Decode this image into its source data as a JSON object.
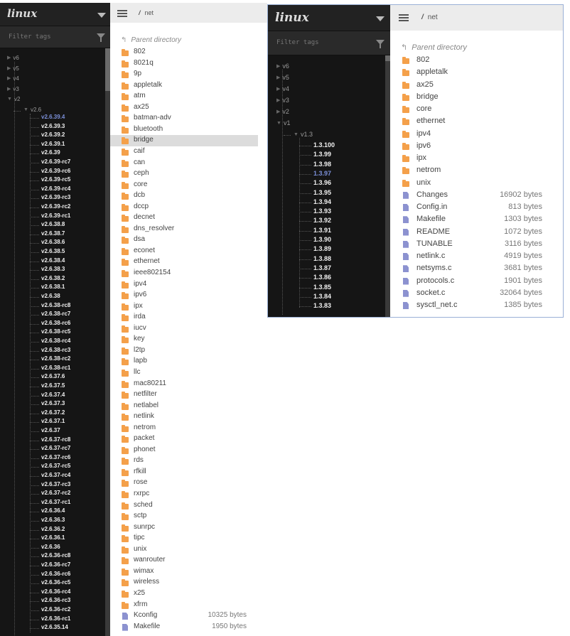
{
  "win1": {
    "logo": "linux",
    "filter_placeholder": "Filter tags",
    "tree_top": [
      "v6",
      "v5",
      "v4",
      "v3",
      "v2"
    ],
    "branch": "v2.6",
    "tags": [
      "v2.6.39.4",
      "v2.6.39.3",
      "v2.6.39.2",
      "v2.6.39.1",
      "v2.6.39",
      "v2.6.39-rc7",
      "v2.6.39-rc6",
      "v2.6.39-rc5",
      "v2.6.39-rc4",
      "v2.6.39-rc3",
      "v2.6.39-rc2",
      "v2.6.39-rc1",
      "v2.6.38.8",
      "v2.6.38.7",
      "v2.6.38.6",
      "v2.6.38.5",
      "v2.6.38.4",
      "v2.6.38.3",
      "v2.6.38.2",
      "v2.6.38.1",
      "v2.6.38",
      "v2.6.38-rc8",
      "v2.6.38-rc7",
      "v2.6.38-rc6",
      "v2.6.38-rc5",
      "v2.6.38-rc4",
      "v2.6.38-rc3",
      "v2.6.38-rc2",
      "v2.6.38-rc1",
      "v2.6.37.6",
      "v2.6.37.5",
      "v2.6.37.4",
      "v2.6.37.3",
      "v2.6.37.2",
      "v2.6.37.1",
      "v2.6.37",
      "v2.6.37-rc8",
      "v2.6.37-rc7",
      "v2.6.37-rc6",
      "v2.6.37-rc5",
      "v2.6.37-rc4",
      "v2.6.37-rc3",
      "v2.6.37-rc2",
      "v2.6.37-rc1",
      "v2.6.36.4",
      "v2.6.36.3",
      "v2.6.36.2",
      "v2.6.36.1",
      "v2.6.36",
      "v2.6.36-rc8",
      "v2.6.36-rc7",
      "v2.6.36-rc6",
      "v2.6.36-rc5",
      "v2.6.36-rc4",
      "v2.6.36-rc3",
      "v2.6.36-rc2",
      "v2.6.36-rc1",
      "v2.6.35.14"
    ],
    "selected_tag": "v2.6.39.4",
    "breadcrumb_sep": "/",
    "breadcrumb": "net",
    "parent_label": "Parent directory",
    "dirs": [
      "802",
      "8021q",
      "9p",
      "appletalk",
      "atm",
      "ax25",
      "batman-adv",
      "bluetooth",
      "bridge",
      "caif",
      "can",
      "ceph",
      "core",
      "dcb",
      "dccp",
      "decnet",
      "dns_resolver",
      "dsa",
      "econet",
      "ethernet",
      "ieee802154",
      "ipv4",
      "ipv6",
      "ipx",
      "irda",
      "iucv",
      "key",
      "l2tp",
      "lapb",
      "llc",
      "mac80211",
      "netfilter",
      "netlabel",
      "netlink",
      "netrom",
      "packet",
      "phonet",
      "rds",
      "rfkill",
      "rose",
      "rxrpc",
      "sched",
      "sctp",
      "sunrpc",
      "tipc",
      "unix",
      "wanrouter",
      "wimax",
      "wireless",
      "x25",
      "xfrm"
    ],
    "highlighted_dir": "bridge",
    "files": [
      {
        "name": "Kconfig",
        "size": "10325 bytes"
      },
      {
        "name": "Makefile",
        "size": "1950 bytes"
      }
    ]
  },
  "win2": {
    "logo": "linux",
    "filter_placeholder": "Filter tags",
    "tree_top": [
      "v6",
      "v5",
      "v4",
      "v3",
      "v2",
      "v1"
    ],
    "branch": "v1.3",
    "tags": [
      "1.3.100",
      "1.3.99",
      "1.3.98",
      "1.3.97",
      "1.3.96",
      "1.3.95",
      "1.3.94",
      "1.3.93",
      "1.3.92",
      "1.3.91",
      "1.3.90",
      "1.3.89",
      "1.3.88",
      "1.3.87",
      "1.3.86",
      "1.3.85",
      "1.3.84",
      "1.3.83"
    ],
    "selected_tag": "1.3.97",
    "breadcrumb_sep": "/",
    "breadcrumb": "net",
    "parent_label": "Parent directory",
    "dirs": [
      "802",
      "appletalk",
      "ax25",
      "bridge",
      "core",
      "ethernet",
      "ipv4",
      "ipv6",
      "ipx",
      "netrom",
      "unix"
    ],
    "files": [
      {
        "name": "Changes",
        "size": "16902 bytes"
      },
      {
        "name": "Config.in",
        "size": "813 bytes"
      },
      {
        "name": "Makefile",
        "size": "1303 bytes"
      },
      {
        "name": "README",
        "size": "1072 bytes"
      },
      {
        "name": "TUNABLE",
        "size": "3116 bytes"
      },
      {
        "name": "netlink.c",
        "size": "4919 bytes"
      },
      {
        "name": "netsyms.c",
        "size": "3681 bytes"
      },
      {
        "name": "protocols.c",
        "size": "1901 bytes"
      },
      {
        "name": "socket.c",
        "size": "32064 bytes"
      },
      {
        "name": "sysctl_net.c",
        "size": "1385 bytes"
      }
    ]
  }
}
